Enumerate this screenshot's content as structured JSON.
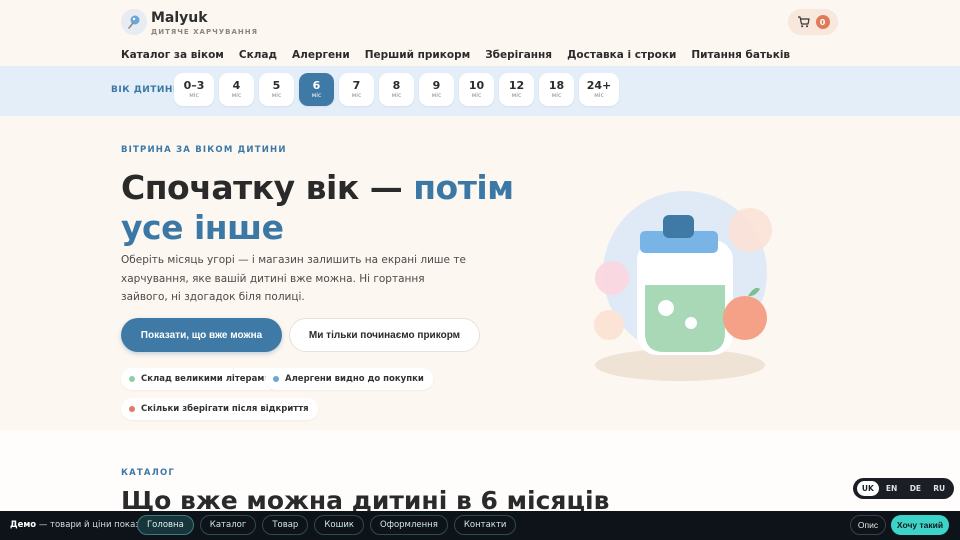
{
  "brand": {
    "name": "Malyuk",
    "subtitle": "ДИТЯЧЕ ХАРЧУВАННЯ"
  },
  "cart": {
    "count": "0"
  },
  "nav": [
    "Каталог за віком",
    "Склад",
    "Алергени",
    "Перший прикорм",
    "Зберігання",
    "Доставка і строки",
    "Питання батьків"
  ],
  "age_selector": {
    "label": "ВІК ДИТИНИ",
    "unit": "міс",
    "selected": "6",
    "options": [
      "0–3",
      "4",
      "5",
      "6",
      "7",
      "8",
      "9",
      "10",
      "12",
      "18",
      "24+"
    ]
  },
  "hero": {
    "eyebrow": "ВІТРИНА ЗА ВІКОМ ДИТИНИ",
    "title_part1": "Спочатку вік — ",
    "title_accent": "потім усе інше",
    "description": "Оберіть місяць угорі — і магазин залишить на екрані лише те харчування, яке вашій дитині вже можна. Ні гортання зайвого, ні здогадок біля полиці.",
    "primary_button": "Показати, що вже можна",
    "secondary_button": "Ми тільки починаємо прикорм",
    "features": [
      {
        "text": "Склад великими літерами",
        "color": "#8ccfa6"
      },
      {
        "text": "Алергени видно до покупки",
        "color": "#6ba7d6"
      },
      {
        "text": "Скільки зберігати після відкриття",
        "color": "#e07b6a"
      }
    ]
  },
  "catalog": {
    "eyebrow": "КАТАЛОГ",
    "title": "Що вже можна дитині в 6 місяців"
  },
  "languages": {
    "items": [
      "UK",
      "EN",
      "DE",
      "RU"
    ],
    "active": "UK"
  },
  "demo_bar": {
    "label_bold": "Демо",
    "label_rest": " — товари й ціни показові:",
    "tabs": [
      "Головна",
      "Каталог",
      "Товар",
      "Кошик",
      "Оформлення",
      "Контакти"
    ],
    "active_tab": "Головна",
    "about": "Опис",
    "cta": "Хочу такий"
  },
  "colors": {
    "accent_blue": "#3b78a6",
    "background": "#fdf7f1",
    "cart_badge": "#e07b5a",
    "demo_cta": "#3ed3c7"
  }
}
